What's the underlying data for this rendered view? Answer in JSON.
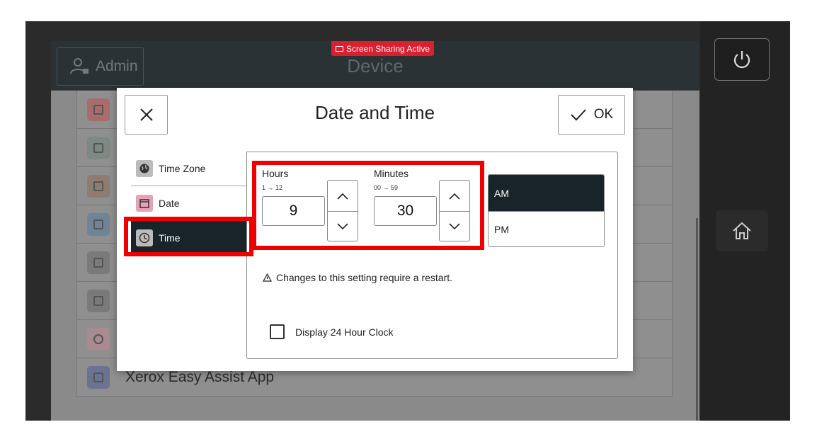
{
  "header": {
    "admin_label": "Admin",
    "app_title": "Device",
    "screen_sharing_badge": "Screen Sharing Active"
  },
  "background_list": {
    "visible_item_label": "Xerox Easy Assist App"
  },
  "dialog": {
    "title": "Date and Time",
    "ok_label": "OK"
  },
  "tabs": [
    {
      "label": "Time Zone",
      "icon": "globe-icon"
    },
    {
      "label": "Date",
      "icon": "calendar-icon"
    },
    {
      "label": "Time",
      "icon": "clock-icon",
      "selected": true
    }
  ],
  "time": {
    "hours_label": "Hours",
    "hours_range": "1 → 12",
    "hours_value": "9",
    "minutes_label": "Minutes",
    "minutes_range": "00 → 59",
    "minutes_value": "30",
    "am_label": "AM",
    "pm_label": "PM",
    "selected_period": "AM"
  },
  "notice": "Changes to this setting require a restart.",
  "display_24h": {
    "label": "Display 24 Hour Clock",
    "checked": false
  },
  "colors": {
    "highlight": "#ee0000",
    "selected_bg": "#18232a",
    "badge": "#d92030"
  }
}
